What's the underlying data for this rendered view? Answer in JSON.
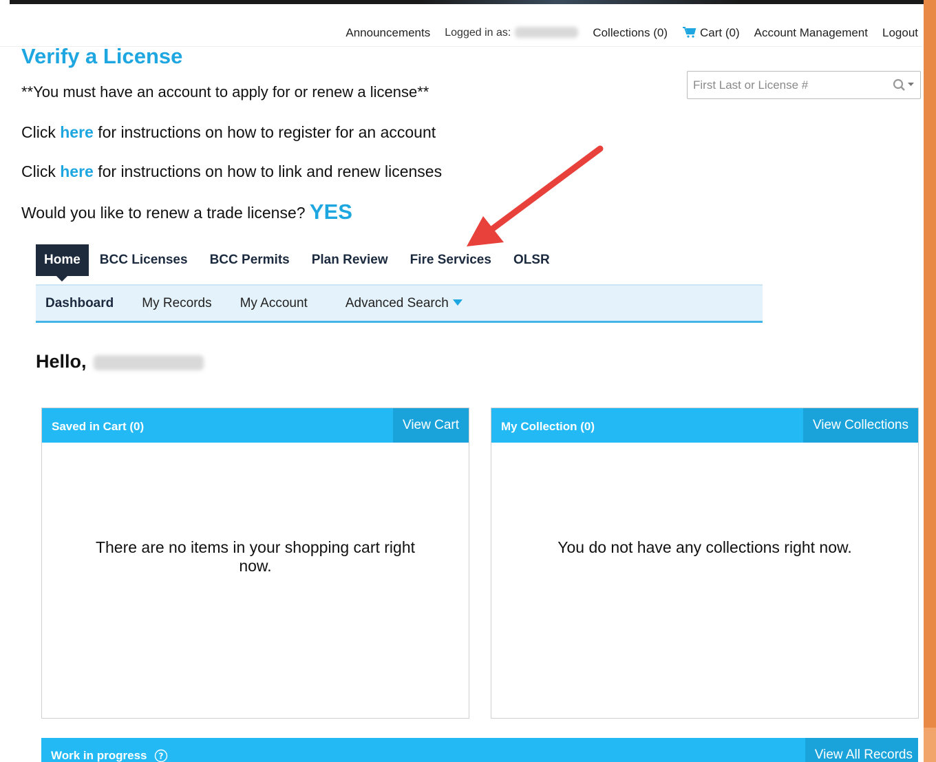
{
  "utility": {
    "announcements": "Announcements",
    "logged_in_label": "Logged in as:",
    "collections": "Collections (0)",
    "cart": "Cart (0)",
    "account_management": "Account Management",
    "logout": "Logout"
  },
  "page": {
    "title": "Verify a License",
    "search_placeholder": "First Last or License #",
    "notice": "**You must have an account to apply for or renew a license**",
    "line1_pre": "Click ",
    "line1_link": "here",
    "line1_post": " for instructions on how to register for an account",
    "line2_pre": "Click ",
    "line2_link": "here",
    "line2_post": " for instructions on how to link and renew licenses",
    "renew_question": "Would you like to renew a trade license? ",
    "renew_yes": "YES"
  },
  "main_nav": {
    "tabs": [
      {
        "label": "Home"
      },
      {
        "label": "BCC Licenses"
      },
      {
        "label": "BCC Permits"
      },
      {
        "label": "Plan Review"
      },
      {
        "label": "Fire Services"
      },
      {
        "label": "OLSR"
      }
    ]
  },
  "sub_nav": {
    "items": [
      {
        "label": "Dashboard"
      },
      {
        "label": "My Records"
      },
      {
        "label": "My Account"
      },
      {
        "label": "Advanced Search"
      }
    ]
  },
  "greeting": "Hello,",
  "cart_panel": {
    "title": "Saved in Cart (0)",
    "button": "View Cart",
    "empty": "There are no items in your shopping cart right now."
  },
  "collection_panel": {
    "title": "My Collection (0)",
    "button": "View Collections",
    "empty": "You do not have any collections right now."
  },
  "wip_panel": {
    "title": "Work in progress",
    "button": "View All Records"
  },
  "colors": {
    "accent": "#1ea6e0",
    "panel_header": "#22b9f5",
    "nav_active": "#1e2b3d",
    "annotation_arrow": "#e8413c"
  }
}
